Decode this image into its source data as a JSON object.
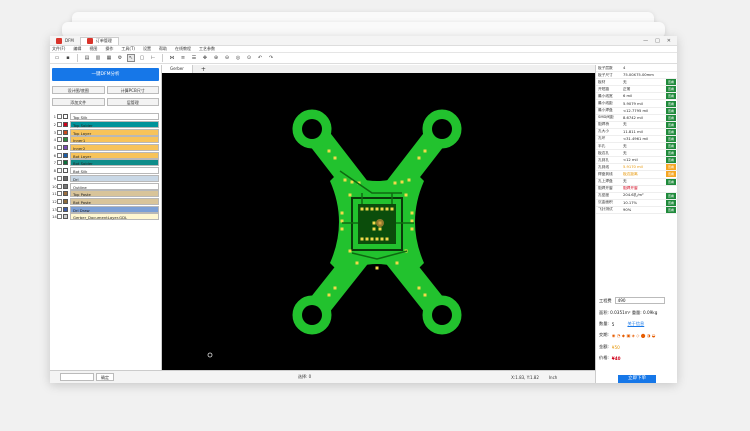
{
  "window": {
    "tabs": [
      {
        "label": "DFM"
      },
      {
        "label": "订单管理"
      }
    ],
    "controls": [
      "—",
      "□",
      "✕"
    ]
  },
  "menu": [
    "文件(F)",
    "编辑",
    "视图",
    "操作",
    "工具(T)",
    "设置",
    "帮助",
    "在线教程",
    "工艺参数"
  ],
  "left_panel": {
    "dfm_button": "一键DFM分析",
    "buttons_row1": [
      "设计图/底图",
      "计算PCB尺寸"
    ],
    "buttons_row2": [
      "添加文件",
      "层管理"
    ],
    "layers": [
      {
        "num": "1",
        "name": "Top Silk",
        "color": "#ffffff",
        "bg": "#ffffff"
      },
      {
        "num": "2",
        "name": "Top Solder",
        "color": "#d0021b",
        "bg": "#00939a"
      },
      {
        "num": "3",
        "name": "Top Layer",
        "color": "#c84a1e",
        "bg": "#f7c35a"
      },
      {
        "num": "4",
        "name": "Inner1",
        "color": "#2b8a3e",
        "bg": "#f7c35a"
      },
      {
        "num": "5",
        "name": "Inner2",
        "color": "#7a4bb7",
        "bg": "#f7c35a"
      },
      {
        "num": "6",
        "name": "Bot Layer",
        "color": "#1d5fa8",
        "bg": "#f7c35a"
      },
      {
        "num": "7",
        "name": "Bot Solder",
        "color": "#0c6e3a",
        "bg": "#0f8d8a"
      },
      {
        "num": "8",
        "name": "Bot Silk",
        "color": "#ffffff",
        "bg": "#ffffff"
      },
      {
        "num": "9",
        "name": "Drl",
        "color": "#6b6b6b",
        "bg": "#c9d8e6"
      },
      {
        "num": "10",
        "name": "Outline",
        "color": "#777777",
        "bg": "#ffffff"
      },
      {
        "num": "11",
        "name": "Top Paste",
        "color": "#9b6e3f",
        "bg": "#d8c49a"
      },
      {
        "num": "12",
        "name": "Bot Paste",
        "color": "#8b6a3b",
        "bg": "#d8c49a"
      },
      {
        "num": "13",
        "name": "Drl Draw",
        "color": "#3b5aa6",
        "bg": "#7b9fd6"
      },
      {
        "num": "14",
        "name": "Gerber_DocumentLayer.GDL",
        "color": "#cccccc",
        "bg": "#fff7d1"
      }
    ]
  },
  "canvas": {
    "tab_label": "Gerber",
    "plus": "+",
    "background": "#000000",
    "board_color": "#22c22e",
    "pad_color": "#f2d94a"
  },
  "statusbar": {
    "left_button": "确定",
    "selection": "选择: 0",
    "coords": "X:1.83, Y:1.82",
    "unit": "Inch"
  },
  "right_panel": {
    "params": [
      {
        "k": "板子层数",
        "v": "4",
        "btn": ""
      },
      {
        "k": "板子尺寸",
        "v": "75.00X75.00mm",
        "btn": ""
      },
      {
        "k": "板材",
        "v": "无",
        "btn": "查看"
      },
      {
        "k": "开短路",
        "v": "正常",
        "btn": "查看"
      },
      {
        "k": "最小线宽",
        "v": "6 mil",
        "btn": "查看"
      },
      {
        "k": "最小线距",
        "v": "5.9079 mil",
        "btn": "查看"
      },
      {
        "k": "最小焊盘",
        "v": "<12.7795 mil",
        "btn": "查看"
      },
      {
        "k": "SMD间距",
        "v": "8.6742 mil",
        "btn": "查看"
      },
      {
        "k": "阻焊桥",
        "v": "无",
        "btn": "查看"
      },
      {
        "k": "孔大小",
        "v": "11.811 mil",
        "btn": "查看"
      },
      {
        "k": "孔环",
        "v": "<31.4961 mil",
        "btn": "查看"
      },
      {
        "k": "半孔",
        "v": "无",
        "btn": "查看"
      },
      {
        "k": "板边孔",
        "v": "无",
        "btn": "查看"
      },
      {
        "k": "孔到孔",
        "v": "<12 mil",
        "btn": "查看"
      },
      {
        "k": "孔到线",
        "v": "5.9170 mil",
        "btn": "查看",
        "warn": true
      },
      {
        "k": "焊盘到线",
        "v": "板边距离",
        "btn": "查看",
        "warn": true
      },
      {
        "k": "孔上焊盘",
        "v": "无",
        "btn": "查看"
      },
      {
        "k": "阻焊开窗",
        "v": "阻焊开窗",
        "btn": "",
        "red": true
      },
      {
        "k": "孔密度",
        "v": "204.6孔/m²",
        "btn": "查看"
      },
      {
        "k": "沉金面积",
        "v": "10.17%",
        "btn": "查看"
      },
      {
        "k": "飞针测试",
        "v": "90%",
        "btn": "查看"
      }
    ],
    "process": {
      "label": "工程费",
      "value": "490"
    },
    "area": "面积: 0.0351m²  重量: 0.09kg",
    "qty_label": "数量:",
    "qty": "5",
    "qty_link": "关于信息",
    "delivery_label": "交期:",
    "price1_label": "金额:",
    "price1": "¥50",
    "price2_label": "价格:",
    "price2": "¥40",
    "order_button": "立即下单"
  }
}
